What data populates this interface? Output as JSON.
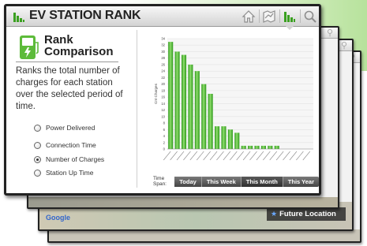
{
  "app": {
    "title": "EV STATION RANK"
  },
  "header": {
    "nav_icons": [
      "home-icon",
      "map-icon",
      "chart-icon",
      "search-icon"
    ],
    "active_nav": "chart-icon"
  },
  "panel": {
    "title_line1": "Rank",
    "title_line2": "Comparison",
    "description": "Ranks the total number of charges for each station over the selected period of time.",
    "options": [
      {
        "label": "Power Delivered",
        "checked": false
      },
      {
        "label": "Connection Time",
        "checked": false
      },
      {
        "label": "Number of Charges",
        "checked": true
      },
      {
        "label": "Station Up Time",
        "checked": false
      }
    ]
  },
  "time_span": {
    "label": "Time Span:",
    "buttons": [
      "Today",
      "This Week",
      "This Month",
      "This Year"
    ],
    "selected": "This Month"
  },
  "background": {
    "future_location": "Future Location",
    "google_logo": "Google"
  },
  "colors": {
    "bar_light": "#8fdc6d",
    "bar_dark": "#2d9a1a",
    "accent": "#3aa020"
  },
  "chart_data": {
    "type": "bar",
    "ylabel": "Cnt Charges",
    "ylim": [
      0,
      34
    ],
    "yticks": [
      0,
      2,
      4,
      6,
      8,
      10,
      12,
      14,
      16,
      18,
      20,
      22,
      24,
      26,
      28,
      30,
      32,
      34
    ],
    "grid": true,
    "values": [
      33,
      30,
      29,
      26,
      24,
      20,
      17,
      7,
      7,
      6,
      5,
      1,
      1,
      1,
      1,
      1,
      1,
      0,
      0,
      0,
      0,
      0
    ]
  }
}
